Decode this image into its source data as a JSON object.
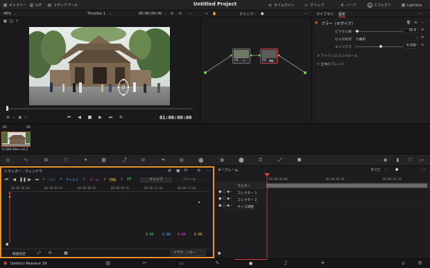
{
  "topbar": {
    "gallery": "ギャラリー",
    "lut": "LUT",
    "media_pool": "メディアプール",
    "project_title": "Untitled Project",
    "timeline": "タイムライン",
    "clip": "クリップ",
    "node": "ノード",
    "effect": "エフェクト",
    "lightbox": "Lightbox"
  },
  "subbar": {
    "zoom": "49%",
    "timeline_name": "Timeline 1",
    "timecode": "00:00:00:00",
    "clip_mode": "クリップ",
    "library_tab": "ライブラリ",
    "settings_tab": "設定"
  },
  "viewer": {
    "timecode": "01:00:00:00",
    "playhead_fraction": 0.0
  },
  "nodes": [
    {
      "label": "01"
    },
    {
      "label": "02"
    }
  ],
  "settings": {
    "effect_title": "ブラー（モザイク）",
    "params": [
      {
        "name": "ピクセル数",
        "value": "30.0"
      },
      {
        "name": "セルの形状",
        "value": "六角形"
      },
      {
        "name": "エイリアス",
        "value": "0.100"
      }
    ],
    "advanced": "> アドバンスコントロール",
    "blend": "> 全体のブレンド"
  },
  "clips": {
    "index": "01",
    "track": "V1",
    "codec": "H.264 Main L4.2"
  },
  "tracker": {
    "title": "トラッカー - ウィンドウ",
    "pan": "パン",
    "tilt": "ティルト",
    "zoom": "ズーム",
    "rotate": "回転",
    "three_d": "3D",
    "clip_btn": "クリップ",
    "frame_btn": "フレーム",
    "ruler": [
      "00:00:00:00",
      "00:00:03:01",
      "00:00:06:01",
      "00:00:09:02",
      "00:00:12:03",
      "00:00:15:04"
    ],
    "values": [
      "0.00",
      "0.00",
      "0.00",
      "0.00"
    ],
    "range": "範囲指定",
    "cloud": "クラウ...ッカー",
    "colors": {
      "pan": "#2fb9e8",
      "tilt": "#5aa7ff",
      "zoom": "#e04bd6",
      "rotate": "#e8c545",
      "three_d": "#56d36b"
    }
  },
  "keyframes": {
    "title": "キーフレーム",
    "filter": "すべて",
    "ruler": [
      "00:00:00:00",
      "00:00:06:40",
      "00:00:13:20"
    ],
    "rows": [
      "マスター",
      "コレクター 1",
      "コレクター 2",
      "サイズ調整"
    ]
  },
  "bottom": {
    "app_name": "DaVinci Resolve 18"
  }
}
